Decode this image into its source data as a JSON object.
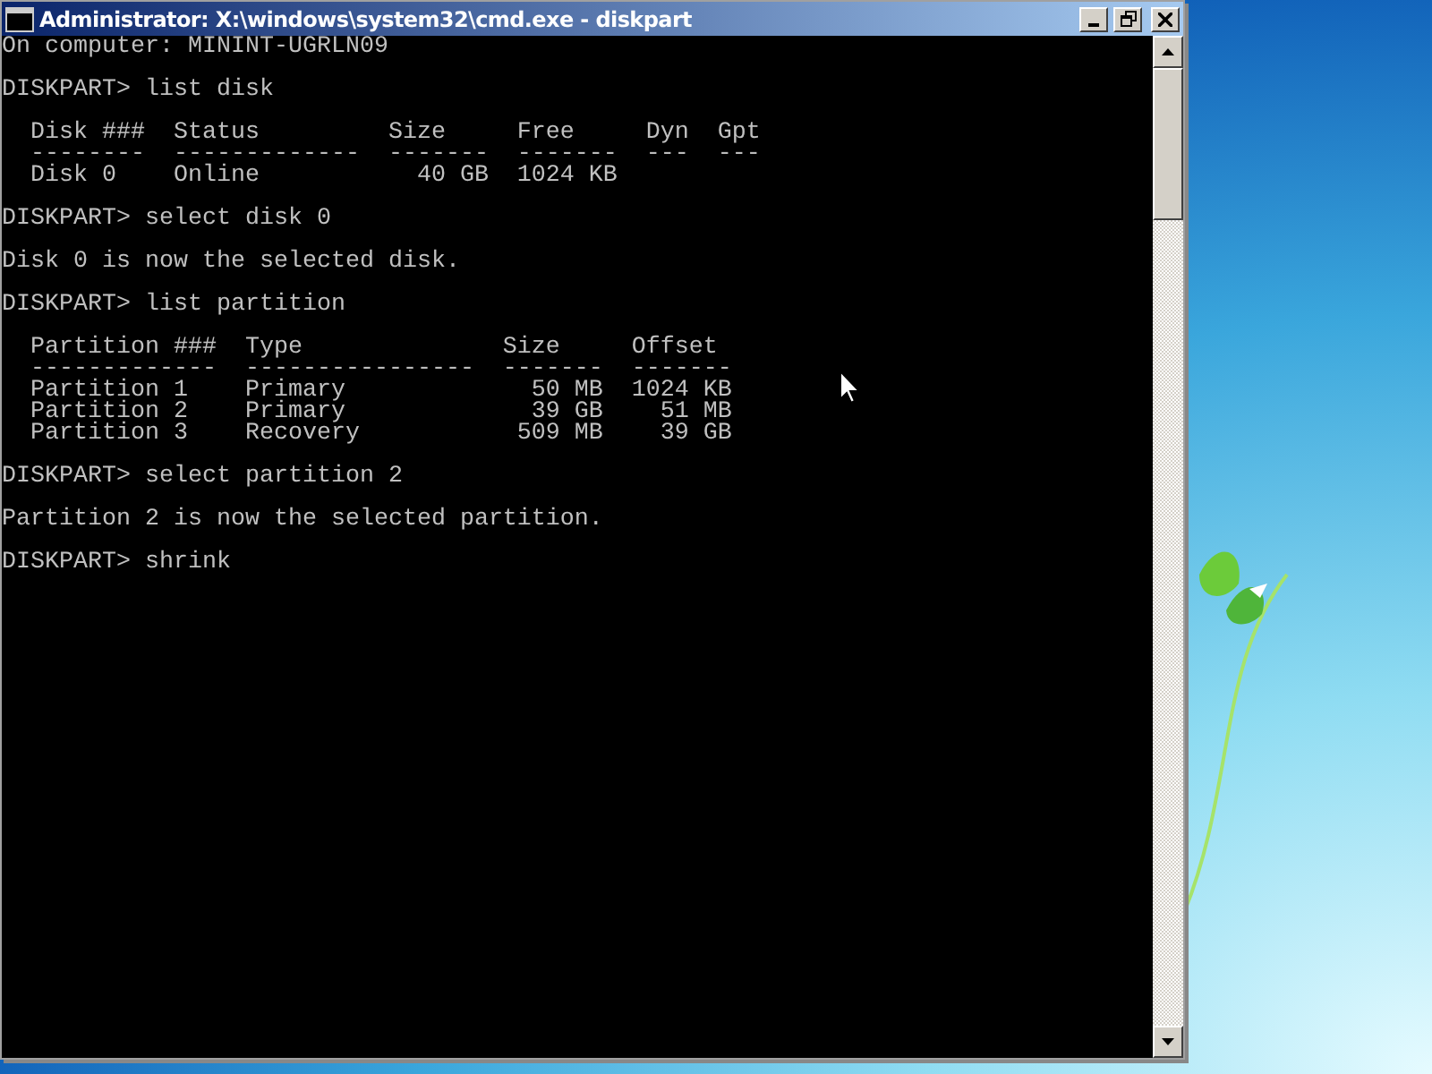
{
  "window": {
    "title": "Administrator: X:\\windows\\system32\\cmd.exe - diskpart"
  },
  "console": {
    "blocks": [
      [
        "On computer: MININT-UGRLN09"
      ],
      [
        "DISKPART> list disk"
      ],
      [
        "  Disk ###  Status         Size     Free     Dyn  Gpt",
        "  --------  -------------  -------  -------  ---  ---",
        "  Disk 0    Online           40 GB  1024 KB"
      ],
      [
        "DISKPART> select disk 0"
      ],
      [
        "Disk 0 is now the selected disk."
      ],
      [
        "DISKPART> list partition"
      ],
      [
        "  Partition ###  Type              Size     Offset",
        "  -------------  ----------------  -------  -------",
        "  Partition 1    Primary             50 MB  1024 KB",
        "  Partition 2    Primary             39 GB    51 MB",
        "  Partition 3    Recovery           509 MB    39 GB"
      ],
      [
        "DISKPART> select partition 2"
      ],
      [
        "Partition 2 is now the selected partition."
      ],
      [
        "DISKPART> shrink"
      ]
    ]
  }
}
